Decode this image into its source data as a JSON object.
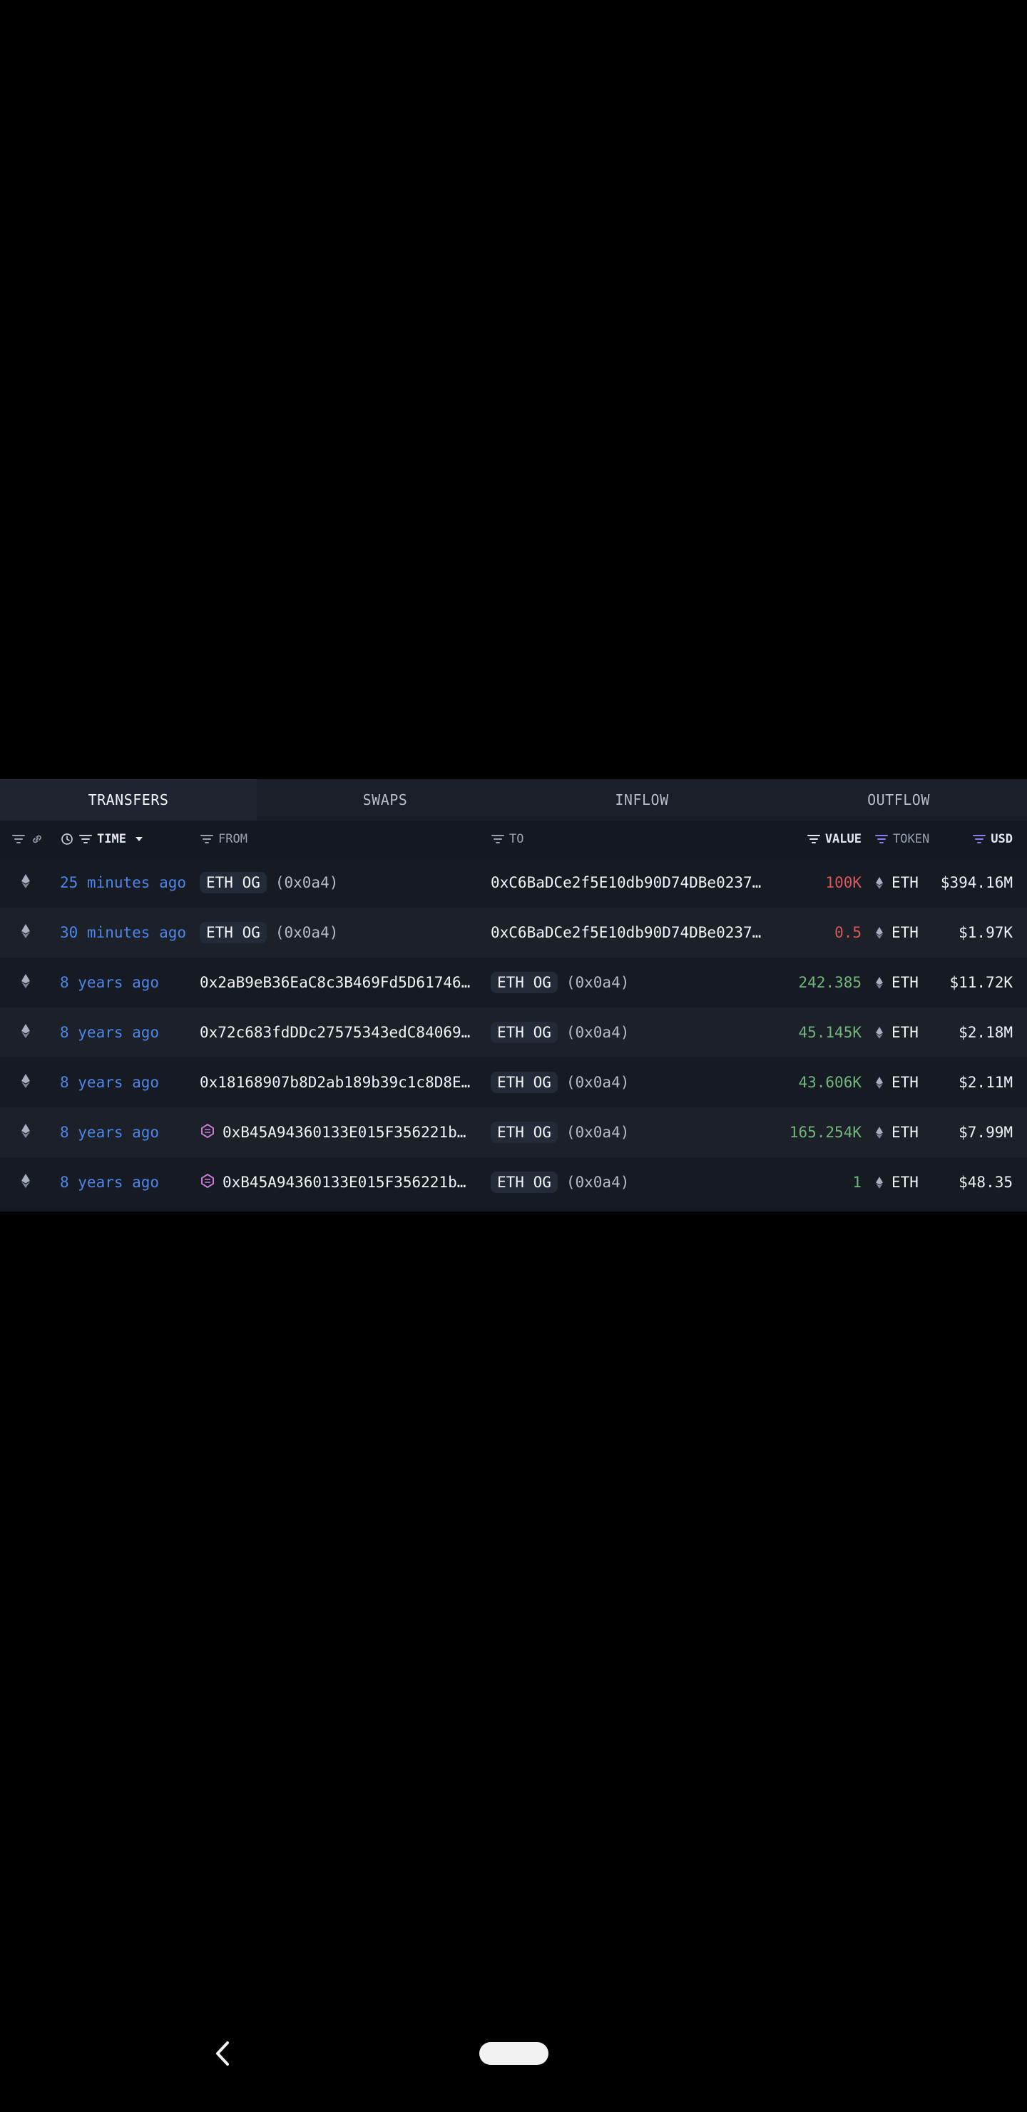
{
  "tabs": [
    {
      "label": "TRANSFERS",
      "active": true
    },
    {
      "label": "SWAPS",
      "active": false
    },
    {
      "label": "INFLOW",
      "active": false
    },
    {
      "label": "OUTFLOW",
      "active": false
    }
  ],
  "columns": {
    "time": "TIME",
    "from": "FROM",
    "to": "TO",
    "value": "VALUE",
    "token": "TOKEN",
    "usd": "USD"
  },
  "rows": [
    {
      "time": "25 minutes ago",
      "from_label": "ETH OG",
      "from_hint": "(0x0a4)",
      "to_address": "0xC6BaDCe2f5E10db90D74DBe0237…",
      "value": "100K",
      "value_type": "neg",
      "token": "ETH",
      "usd": "$394.16M"
    },
    {
      "time": "30 minutes ago",
      "from_label": "ETH OG",
      "from_hint": "(0x0a4)",
      "to_address": "0xC6BaDCe2f5E10db90D74DBe0237…",
      "value": "0.5",
      "value_type": "neg",
      "token": "ETH",
      "usd": "$1.97K"
    },
    {
      "time": "8 years ago",
      "from_address": "0x2aB9eB36EaC8c3B469Fd5D61746…",
      "to_label": "ETH OG",
      "to_hint": "(0x0a4)",
      "value": "242.385",
      "value_type": "pos",
      "token": "ETH",
      "usd": "$11.72K"
    },
    {
      "time": "8 years ago",
      "from_address": "0x72c683fdDDc27575343edC84069…",
      "to_label": "ETH OG",
      "to_hint": "(0x0a4)",
      "value": "45.145K",
      "value_type": "pos",
      "token": "ETH",
      "usd": "$2.18M"
    },
    {
      "time": "8 years ago",
      "from_address": "0x18168907b8D2ab189b39c1c8D8E…",
      "to_label": "ETH OG",
      "to_hint": "(0x0a4)",
      "value": "43.606K",
      "value_type": "pos",
      "token": "ETH",
      "usd": "$2.11M"
    },
    {
      "time": "8 years ago",
      "from_address": "0xB45A94360133E015F356221b…",
      "from_entity_icon": "exchange-entity-icon",
      "to_label": "ETH OG",
      "to_hint": "(0x0a4)",
      "value": "165.254K",
      "value_type": "pos",
      "token": "ETH",
      "usd": "$7.99M"
    },
    {
      "time": "8 years ago",
      "from_address": "0xB45A94360133E015F356221b…",
      "from_entity_icon": "exchange-entity-icon",
      "to_label": "ETH OG",
      "to_hint": "(0x0a4)",
      "value": "1",
      "value_type": "pos",
      "token": "ETH",
      "usd": "$48.35"
    }
  ],
  "colors": {
    "time_link": "#4d86e8",
    "outflow_value": "#d8575b",
    "inflow_value": "#72b57c",
    "panel_background": "#141821",
    "entity_icon": "#c87ad6"
  },
  "icons": {
    "chain": "ethereum-icon",
    "filter": "filter-icon",
    "link": "link-icon",
    "clock": "clock-icon",
    "sort": "sort-desc-icon",
    "back": "back-chevron-icon"
  }
}
